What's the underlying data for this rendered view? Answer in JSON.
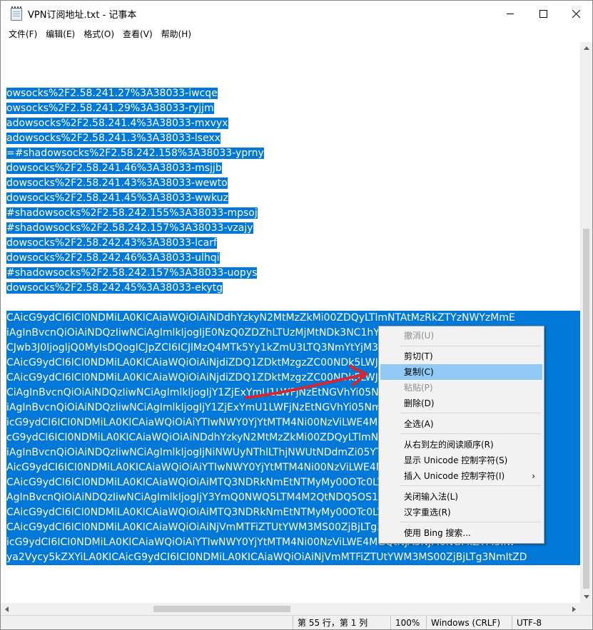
{
  "window": {
    "title": "VPN订阅地址.txt - 记事本",
    "controls": [
      "minimize-icon",
      "maximize-icon",
      "close-icon"
    ]
  },
  "menubar": {
    "items": [
      "文件(F)",
      "编辑(E)",
      "格式(O)",
      "查看(V)",
      "帮助(H)"
    ]
  },
  "editor": {
    "lines": [
      "owsocks%2F2.58.241.27%3A38033-iwcqe",
      "owsocks%2F2.58.241.29%3A38033-ryjjm",
      "adowsocks%2F2.58.241.4%3A38033-mxvyx",
      "adowsocks%2F2.58.241.3%3A38033-lsexx",
      "=#shadowsocks%2F2.58.242.158%3A38033-yprny",
      "dowsocks%2F2.58.241.46%3A38033-msjjb",
      "dowsocks%2F2.58.241.43%3A38033-wewto",
      "dowsocks%2F2.58.241.45%3A38033-wwkuz",
      "#shadowsocks%2F2.58.242.155%3A38033-mpsoj",
      "#shadowsocks%2F2.58.242.157%3A38033-vzajy",
      "dowsocks%2F2.58.242.43%3A38033-lcarf",
      "dowsocks%2F2.58.242.46%3A38033-ulhqi",
      "#shadowsocks%2F2.58.242.157%3A38033-uopys",
      "dowsocks%2F2.58.242.45%3A38033-ekytg"
    ],
    "encoded_lines": [
      "CAicG9ydCI6ICI0NDMiLA0KICAiaWQiOiAiNDdhYzkyN2MtMzZkMi00ZDQyLTlmNTAtMzRkZTYzNWYzMmE",
      "iAgInBvcnQiOiAiNDQzIiwNCiAgImlkIjogIjE0NzQ0ZDZhLTUzMjMtNDk3NC1hYWMzLWU4ZGY2NTFkZjVEwNC",
      "CJwb3J0IjogIjQ0MyIsDQogICJpZCI6ICJlMzQ4MTk5Yy1kZmU3LTQ3NmYtYjM3Mi1kMzQ4NzNkMjhkNWIiLA",
      "CAicG9ydCI6ICI0NDMiLA0KICAiaWQiOiAiNjdiZDQ1ZDktMzgzZC00NDk5LWJiNjQtOTFkYmQ5ZmJmNWI4iw",
      "CAicG9ydCI6ICI0NDMiLA0KICAiaWQiOiAiNjdiZDQ1ZDktMzgzZC00NDk5LWJiNjQtOTFkYmQ5ZmJmNWI4iw",
      "CiAgInBvcnQiOiAiNDQzIiwNCiAgImlkIjogIjY1ZjExYmU1LWFjNzEtNGVhYi05NmRjLWFlNzE5ZjNjZlZiIs",
      "iAgInBvcnQiOiAiNDQzIiwNCiAgImlkIjogIjY1ZjExYmU1LWFjNzEtNGVhYi05NmRjLWFlNzE5ZjNjZlZiIsD",
      "icG9ydCI6ICI0NDMiLA0KICAiaWQiOiAiYTIwNWY0YjYtMTM4Ni00NzViLWE4MGQtNjA5NjM0NGFkZTM3Iiw",
      "cG9ydCI6ICI0NDMiLA0KICAiaWQiOiAiNDdhYzkyN2MtMzZkMi00ZDQyLTlmNTAtMzRkZTYzNWYzMmE1Iiw",
      "iAgInBvcnQiOiAiNDQzIiwNCiAgImlkIjogIjNiNWUyNThlLThjNWUtNDdmZi05YTk2LTM3ZjY0ZmY0ZGJiMi",
      "AicG9ydCI6ICI0NDMiLA0KICAiaWQiOiAiYTIwNWY0YjYtMTM4Ni00NzViLWE4MGQtNjA5NjM0NGFkZTM3Iiw",
      "CAicG9ydCI6ICI0NDMiLA0KICAiaWQiOiAiMTQ3NDRkNmEtNTMyMy00OTc0LWFhYzMtZThkZjY1MWRlYTAi",
      "AgInBvcnQiOiAiNDQzIiwNCiAgImlkIjogIjY3YmQ0NWQ5LTM4M2QtNDQ5OS1iYjY0LTkxZGJkOWZiZjFiOiC",
      "CAicG9ydCI6ICI0NDMiLA0KICAiaWQiOiAiMTQ3NDRkNmEtNTMyMy00OTc0LWFhYzMtZThkZjY1MWRlYTAi",
      "CAicG9ydCI6ICI0NDMiLA0KICAiaWQiOiAiNjVmMTFiZTUtYWM3MS00ZjBjLTg3NmUtYWU3MTlmM2NmZmVi",
      "icG9ydCI6ICI0NDMiLA0KICAiaWQiOiAiYTIwNWY0YjYtMTM4Ni00NzViLWE4MGQtNjA5NjM0NGFkZTM3Iiw",
      "ya2Vycy5kZXYiLA0KICAicG9ydCI6ICI0NDMiLA0KICAiaWQiOiAiNjVmMTFiZTUtYWM3MS00ZjBjLTg3NmItZD"
    ]
  },
  "context_menu": {
    "items": [
      {
        "label": "撤消(U)",
        "disabled": true
      },
      {
        "label": "剪切(T)",
        "disabled": false
      },
      {
        "label": "复制(C)",
        "disabled": false,
        "hover": true
      },
      {
        "label": "粘贴(P)",
        "disabled": true
      },
      {
        "label": "删除(D)",
        "disabled": false
      },
      {
        "label": "全选(A)",
        "disabled": false
      },
      {
        "label": "从右到左的阅读顺序(R)",
        "disabled": false
      },
      {
        "label": "显示 Unicode 控制字符(S)",
        "disabled": false
      },
      {
        "label": "插入 Unicode 控制字符(I)",
        "disabled": false,
        "submenu": true
      },
      {
        "label": "关闭输入法(L)",
        "disabled": false
      },
      {
        "label": "汉字重选(R)",
        "disabled": false
      },
      {
        "label": "使用 Bing 搜索...",
        "disabled": false
      }
    ]
  },
  "statusbar": {
    "position": "第 55 行，第 1 列",
    "zoom": "100%",
    "line_ending": "Windows (CRLF)",
    "encoding": "UTF-8"
  },
  "colors": {
    "selection": "#0078d7",
    "menu_hover": "#91c9f7",
    "annotation_arrow": "#d9262e"
  }
}
